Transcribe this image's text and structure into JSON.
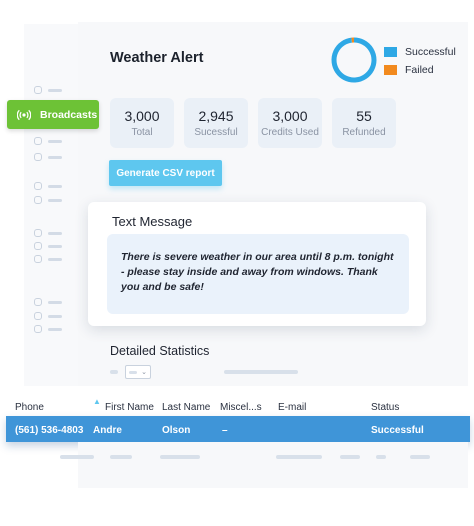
{
  "nav": {
    "active_label": "Broadcasts"
  },
  "header": {
    "title": "Weather Alert"
  },
  "chart_data": {
    "type": "pie",
    "categories": [
      "Successful",
      "Failed"
    ],
    "values": [
      2945,
      55
    ],
    "colors": [
      "#2ea8e5",
      "#f28a1e"
    ]
  },
  "legend": [
    {
      "label": "Successful",
      "color": "#2ea8e5"
    },
    {
      "label": "Failed",
      "color": "#f28a1e"
    }
  ],
  "stats": [
    {
      "value": "3,000",
      "label": "Total"
    },
    {
      "value": "2,945",
      "label": "Sucessful"
    },
    {
      "value": "3,000",
      "label": "Credits Used"
    },
    {
      "value": "55",
      "label": "Refunded"
    }
  ],
  "actions": {
    "csv_label": "Generate CSV report"
  },
  "message": {
    "title": "Text Message",
    "body": "There is severe weather in our area until 8 p.m. tonight - please stay inside and away from windows. Thank you and be safe!"
  },
  "details": {
    "title": "Detailed Statistics"
  },
  "table": {
    "columns": [
      "Phone",
      "First Name",
      "Last Name",
      "Miscel...s",
      "E-mail",
      "Status"
    ],
    "rows": [
      [
        "(561) 536-4803",
        "Andre",
        "Olson",
        "–",
        "",
        "Successful"
      ]
    ]
  }
}
